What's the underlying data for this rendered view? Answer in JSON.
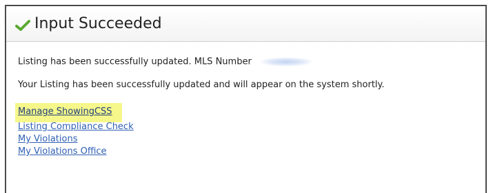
{
  "panel": {
    "title": "Input Succeeded",
    "status_icon": "check-icon",
    "accent_color": "#5aa832"
  },
  "messages": {
    "updated_prefix": "Listing has been successfully updated. MLS Number",
    "appear_text": "Your Listing has been successfully updated and will appear on the system shortly."
  },
  "links": [
    {
      "label": "Manage ShowingCSS",
      "highlighted": true,
      "highlight_color": "#f6f78a"
    },
    {
      "label": "Listing Compliance Check"
    },
    {
      "label": "My Violations"
    },
    {
      "label": "My Violations Office"
    }
  ]
}
